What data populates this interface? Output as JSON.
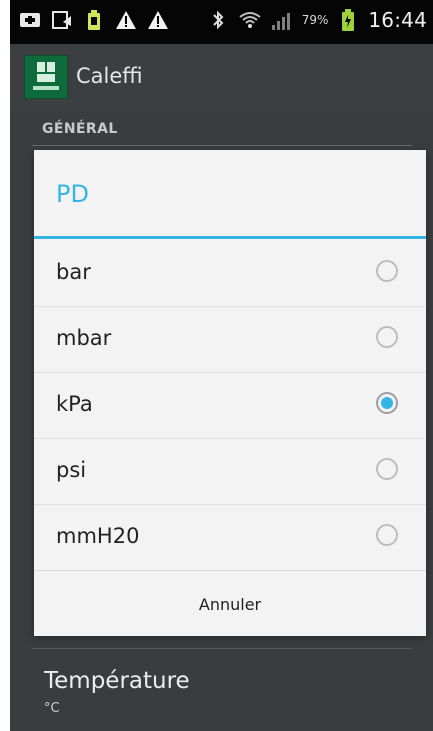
{
  "status_bar": {
    "battery_percent": "79%",
    "time": "16:44",
    "icons": [
      "add-icon",
      "cast-icon",
      "battery-saver-icon",
      "warning-icon",
      "warning-icon",
      "bluetooth-icon",
      "wifi-icon",
      "signal-icon",
      "battery-icon"
    ]
  },
  "app_bar": {
    "title": "Caleffi",
    "logo_icon": "caleffi-logo-icon"
  },
  "settings": {
    "section_header": "GÉNÉRAL",
    "items": [
      {
        "title": "Température",
        "subtitle": "°C"
      }
    ]
  },
  "dialog": {
    "title": "PD",
    "options": [
      {
        "label": "bar",
        "selected": false
      },
      {
        "label": "mbar",
        "selected": false
      },
      {
        "label": "kPa",
        "selected": true
      },
      {
        "label": "psi",
        "selected": false
      },
      {
        "label": "mmH20",
        "selected": false
      }
    ],
    "cancel_label": "Annuler"
  },
  "colors": {
    "accent": "#33b5e5",
    "dialog_bg": "#f3f3f3",
    "background": "#3a3d3f",
    "status_bar": "#050505"
  }
}
